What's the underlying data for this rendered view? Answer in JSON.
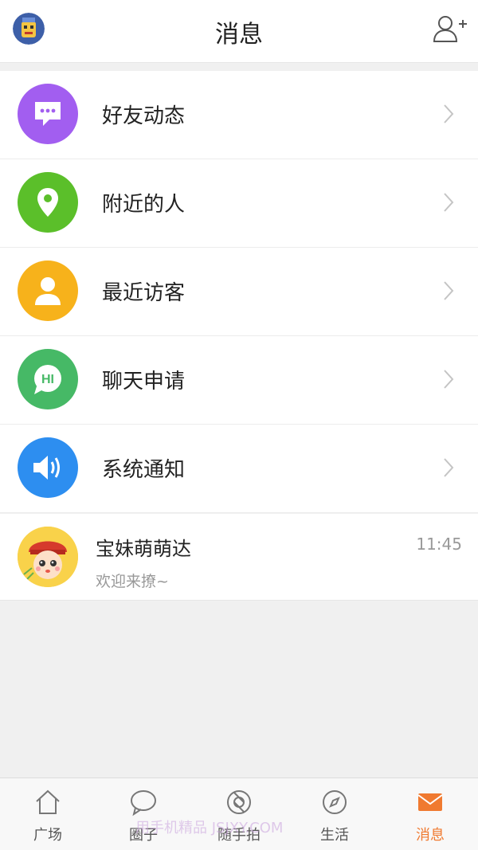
{
  "header": {
    "title": "消息"
  },
  "menu": [
    {
      "label": "好友动态",
      "icon": "chat-dots-icon",
      "color": "#a25ef0"
    },
    {
      "label": "附近的人",
      "icon": "location-pin-icon",
      "color": "#5bbf2a"
    },
    {
      "label": "最近访客",
      "icon": "user-icon",
      "color": "#f7b21b"
    },
    {
      "label": "聊天申请",
      "icon": "hi-bubble-icon",
      "color": "#46b966",
      "bubble_text": "HI"
    },
    {
      "label": "系统通知",
      "icon": "speaker-icon",
      "color": "#2d8ef0"
    }
  ],
  "chat": {
    "name": "宝妹萌萌达",
    "message": "欢迎来撩~",
    "time": "11:45"
  },
  "tabs": [
    {
      "label": "广场",
      "icon": "home-icon"
    },
    {
      "label": "圈子",
      "icon": "bubble-icon"
    },
    {
      "label": "随手拍",
      "icon": "aperture-icon"
    },
    {
      "label": "生活",
      "icon": "compass-icon"
    },
    {
      "label": "消息",
      "icon": "mail-icon",
      "active": true
    }
  ],
  "watermark": "用手机精品 JSJXY.COM",
  "colors": {
    "accent": "#f07a30"
  }
}
